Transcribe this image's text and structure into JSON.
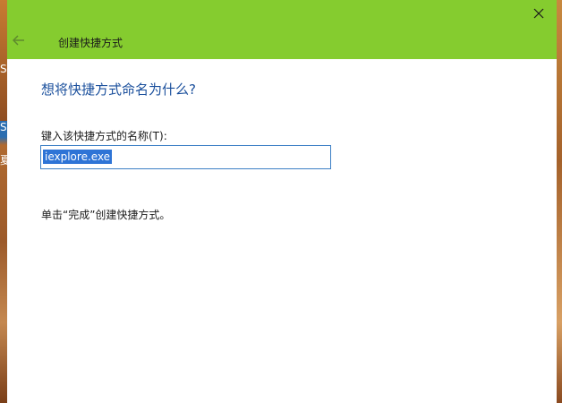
{
  "window": {
    "title": "创建快捷方式",
    "heading": "想将快捷方式命名为什么?",
    "field_label": "键入该快捷方式的名称(T):",
    "name_value": "iexplore.exe",
    "finish_note": "单击“完成”创建快捷方式。"
  },
  "desktop": {
    "glyphs": [
      "S",
      "S",
      "夏"
    ]
  },
  "icons": {
    "close": "close-icon",
    "back": "back-arrow-icon"
  },
  "colors": {
    "title_bar": "#85cc2f",
    "heading": "#1a4f9c",
    "input_border": "#3c7fc5",
    "selection": "#2e74d6"
  }
}
